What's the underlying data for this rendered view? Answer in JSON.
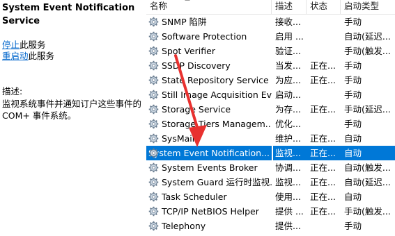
{
  "left_panel": {
    "service_title": "System Event Notification Service",
    "stop_link": "停止",
    "stop_suffix": "此服务",
    "restart_link": "重启动",
    "restart_suffix": "此服务",
    "desc_label": "描述:",
    "description": "监视系统事件并通知订户这些事件的 COM+ 事件系统。"
  },
  "columns": {
    "name": "名称",
    "description": "描述",
    "status": "状态",
    "startup_type": "启动类型"
  },
  "services": [
    {
      "name": "SNMP 陷阱",
      "desc": "接收...",
      "status": "",
      "startup": "手动"
    },
    {
      "name": "Software Protection",
      "desc": "启用 ...",
      "status": "",
      "startup": "自动(延迟..."
    },
    {
      "name": "Spot Verifier",
      "desc": "验证...",
      "status": "",
      "startup": "手动(触发..."
    },
    {
      "name": "SSDP Discovery",
      "desc": "当发...",
      "status": "正在...",
      "startup": "手动"
    },
    {
      "name": "State Repository Service",
      "desc": "为应...",
      "status": "正在...",
      "startup": "手动"
    },
    {
      "name": "Still Image Acquisition Ev...",
      "desc": "启动...",
      "status": "",
      "startup": "手动"
    },
    {
      "name": "Storage Service",
      "desc": "为存...",
      "status": "正在...",
      "startup": "手动(延迟..."
    },
    {
      "name": "Storage Tiers Managem...",
      "desc": "优化...",
      "status": "",
      "startup": "手动"
    },
    {
      "name": "SysMain",
      "desc": "维护...",
      "status": "正在...",
      "startup": "自动"
    },
    {
      "name": "System Event Notification...",
      "desc": "监视...",
      "status": "正在...",
      "startup": "自动",
      "selected": true
    },
    {
      "name": "System Events Broker",
      "desc": "协调...",
      "status": "正在...",
      "startup": "自动(触发..."
    },
    {
      "name": "System Guard 运行时监视...",
      "desc": "监视...",
      "status": "正在...",
      "startup": "自动(延迟..."
    },
    {
      "name": "Task Scheduler",
      "desc": "使用...",
      "status": "正在...",
      "startup": "自动"
    },
    {
      "name": "TCP/IP NetBIOS Helper",
      "desc": "提供 ...",
      "status": "正在...",
      "startup": "手动(触发..."
    },
    {
      "name": "Telephony",
      "desc": "提供...",
      "status": "",
      "startup": "手动"
    }
  ],
  "colors": {
    "selection": "#0078d7",
    "selection_light": "#cce8ff",
    "link": "#0066cc",
    "annotation_arrow": "#e8312f"
  },
  "icons": {
    "service": "gear-icon",
    "annotation": "red-arrow"
  }
}
